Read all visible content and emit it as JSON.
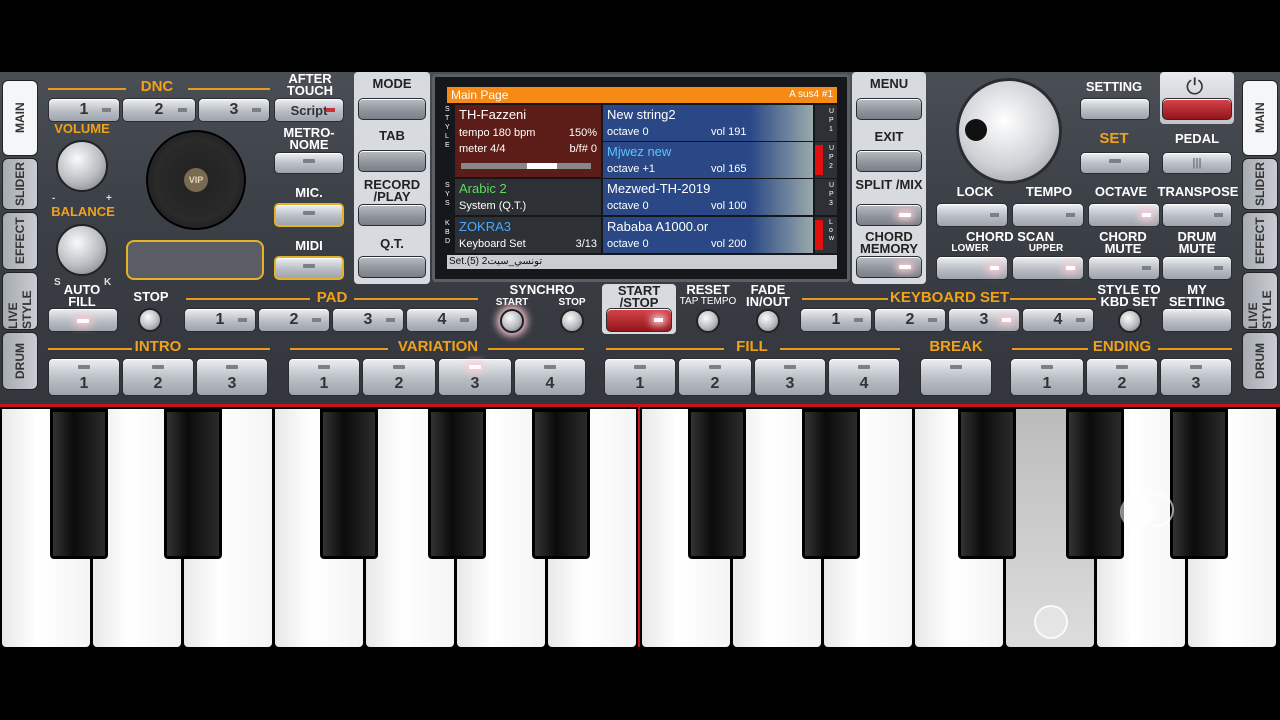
{
  "side_tabs_left": [
    "MAIN",
    "SLIDER",
    "EFFECT",
    "LIVE STYLE",
    "DRUM"
  ],
  "side_tabs_right": [
    "MAIN",
    "SLIDER",
    "EFFECT",
    "LIVE STYLE",
    "DRUM"
  ],
  "labels": {
    "dnc": "DNC",
    "after_touch": "AFTER TOUCH",
    "volume": "VOLUME",
    "balance": "BALANCE",
    "metronome": "METRO- NOME",
    "mic": "MIC.",
    "midi": "MIDI",
    "mode": "MODE",
    "tab": "TAB",
    "record_play": "RECORD /PLAY",
    "qt": "Q.T.",
    "menu": "MENU",
    "exit": "EXIT",
    "split_mix": "SPLIT /MIX",
    "chord_memory": "CHORD MEMORY",
    "setting": "SETTING",
    "set": "SET",
    "pedal": "PEDAL",
    "lock": "LOCK",
    "tempo": "TEMPO",
    "octave": "OCTAVE",
    "transpose": "TRANSPOSE",
    "chord_scan": "CHORD SCAN",
    "lower": "LOWER",
    "upper": "UPPER",
    "chord_mute": "CHORD MUTE",
    "drum_mute": "DRUM MUTE",
    "auto_fill": "AUTO FILL",
    "stop": "STOP",
    "pad": "PAD",
    "synchro": "SYNCHRO",
    "start": "START",
    "stop2": "STOP",
    "start_stop": "START /STOP",
    "reset": "RESET",
    "tap_tempo": "TAP TEMPO",
    "fade": "FADE IN/OUT",
    "keyboard_set": "KEYBOARD SET",
    "style_to_kbd": "STYLE TO KBD SET",
    "my_setting": "MY SETTING",
    "intro": "INTRO",
    "variation": "VARIATION",
    "fill": "FILL",
    "break": "BREAK",
    "ending": "ENDING",
    "vip": "VIP",
    "s": "S",
    "k": "K",
    "minus": "-",
    "plus": "+"
  },
  "dnc_buttons": [
    "1",
    "2",
    "3",
    "Script"
  ],
  "pad_buttons": [
    "1",
    "2",
    "3",
    "4"
  ],
  "kbd_buttons": [
    "1",
    "2",
    "3",
    "4"
  ],
  "intro_buttons": [
    "1",
    "2",
    "3"
  ],
  "variation_buttons": [
    "1",
    "2",
    "3",
    "4"
  ],
  "fill_buttons": [
    "1",
    "2",
    "3",
    "4"
  ],
  "ending_buttons": [
    "1",
    "2",
    "3"
  ],
  "screen": {
    "title": "Main Page",
    "chord": "A sus4 #1",
    "style_name": "TH-Fazzeni",
    "tempo": "tempo 180 bpm",
    "tempo_pct": "150%",
    "meter": "meter 4/4",
    "bf": "b/f# 0",
    "system_name": "Arabic 2",
    "system_sub": "System (Q.T.)",
    "kbd_name": "ZOKRA3",
    "kbd_sub": "Keyboard Set",
    "kbd_count": "3/13",
    "up1_name": "New string2",
    "up1_oct": "octave 0",
    "up1_vol": "vol 191",
    "up2_name": "Mjwez new",
    "up2_oct": "octave +1",
    "up2_vol": "vol 165",
    "up3_name": "Mezwed-TH-2019",
    "up3_oct": "octave 0",
    "up3_vol": "vol 100",
    "low_name": "Rababa A1000.or",
    "low_oct": "octave 0",
    "low_vol": "vol 200",
    "footer": "Set.(5) تونسي_سيت2",
    "left_tags": [
      "S T Y L E",
      "S Y S",
      "K B D"
    ],
    "right_tags": [
      "U P 1",
      "U P 2",
      "U P 3",
      "L o w"
    ]
  },
  "colors": {
    "accent": "#f0a21a",
    "screen_header": "#f58a14",
    "record_red": "#e01010"
  }
}
